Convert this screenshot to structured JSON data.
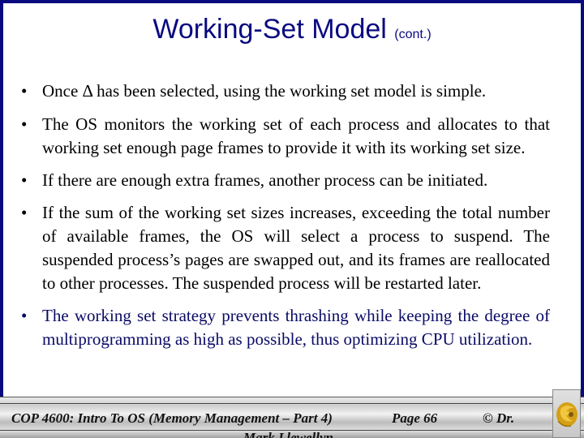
{
  "slide": {
    "title": "Working-Set Model",
    "title_suffix": "(cont.)",
    "bullets": [
      {
        "marker": "•",
        "text": "Once Δ has been selected, using the working set model is simple."
      },
      {
        "marker": "•",
        "text": "The OS monitors the working set of each process and allocates to that working set enough page frames to provide it with its working set size."
      },
      {
        "marker": "•",
        "text": "If there are enough extra frames, another process can be initiated."
      },
      {
        "marker": "•",
        "text": "If the sum of the working set sizes increases, exceeding the total number of available frames, the OS will select a process to suspend.  The suspended process’s pages are swapped out, and its frames are reallocated to other processes.  The suspended process will be restarted later."
      },
      {
        "marker": "•",
        "text": "The working set strategy prevents thrashing while keeping the degree of multiprogramming as high as possible, thus optimizing CPU utilization."
      }
    ]
  },
  "footer": {
    "course": "COP 4600: Intro To OS  (Memory Management – Part 4)",
    "page": "Page 66",
    "copyright": "© Dr.",
    "author": "Mark Llewellyn"
  },
  "colors": {
    "title": "#0a0a80",
    "border": "#0a0a80",
    "accent_text": "#0a0a66",
    "logo_gold": "#d4a017"
  },
  "icons": {
    "logo": "ucf-pegasus-logo-icon"
  }
}
